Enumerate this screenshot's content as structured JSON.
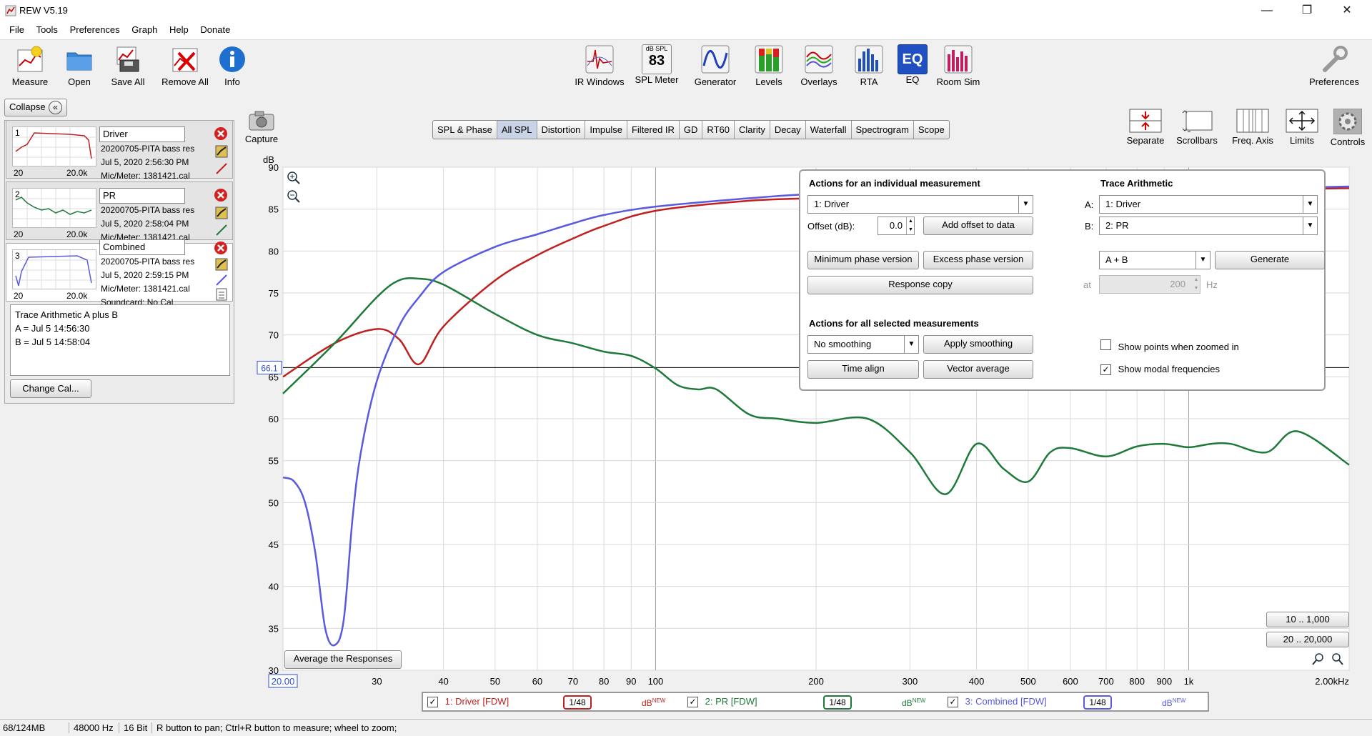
{
  "window": {
    "title": "REW V5.19",
    "controls": {
      "minimize": "—",
      "restore": "❐",
      "close": "✕"
    }
  },
  "menu": [
    "File",
    "Tools",
    "Preferences",
    "Graph",
    "Help",
    "Donate"
  ],
  "toolbar_left": [
    {
      "label": "Measure",
      "icon": "measure-icon"
    },
    {
      "label": "Open",
      "icon": "folder-icon"
    },
    {
      "label": "Save All",
      "icon": "save-icon"
    },
    {
      "label": "Remove All",
      "icon": "remove-icon"
    },
    {
      "label": "Info",
      "icon": "info-icon"
    }
  ],
  "toolbar_mid": [
    {
      "label": "IR Windows",
      "icon": "ir-windows-icon"
    },
    {
      "label": "SPL Meter",
      "icon": "spl-meter-icon"
    },
    {
      "label": "Generator",
      "icon": "generator-icon"
    },
    {
      "label": "Levels",
      "icon": "levels-icon"
    },
    {
      "label": "Overlays",
      "icon": "overlays-icon"
    },
    {
      "label": "RTA",
      "icon": "rta-icon"
    },
    {
      "label": "EQ",
      "icon": "eq-icon"
    },
    {
      "label": "Room Sim",
      "icon": "room-sim-icon"
    }
  ],
  "spl_meter_icon": {
    "top": "dB SPL",
    "value": "83"
  },
  "eq_icon_text": "EQ",
  "preferences": "Preferences",
  "graph_tools": [
    "Separate",
    "Scrollbars",
    "Freq. Axis",
    "Limits",
    "Controls"
  ],
  "capture": "Capture",
  "collapse": "Collapse",
  "tabs": [
    "SPL & Phase",
    "All SPL",
    "Distortion",
    "Impulse",
    "Filtered IR",
    "GD",
    "RT60",
    "Clarity",
    "Decay",
    "Waterfall",
    "Spectrogram",
    "Scope"
  ],
  "selected_tab": "All SPL",
  "measurements": [
    {
      "num": "1",
      "name": "Driver",
      "line1": "20200705-PITA bass res",
      "line2": "Jul 5, 2020 2:56:30 PM",
      "line3": "Mic/Meter: 1381421.cal",
      "line4": "S",
      "color": "#c0201f"
    },
    {
      "num": "2",
      "name": "PR",
      "line1": "20200705-PITA bass res",
      "line2": "Jul 5, 2020 2:58:04 PM",
      "line3": "Mic/Meter: 1381421.cal",
      "line4": "S",
      "color": "#1f7a3a"
    },
    {
      "num": "3",
      "name": "Combined",
      "line1": "20200705-PITA bass res",
      "line2": "Jul 5, 2020 2:59:15 PM",
      "line3": "Mic/Meter: 1381421.cal",
      "line4": "Soundcard: No Cal",
      "color": "#5a5ae0"
    }
  ],
  "thumb_axis": {
    "left": "20",
    "right": "20.0k"
  },
  "notes": [
    "Trace Arithmetic A plus B",
    "A = Jul 5 14:56:30",
    "B = Jul 5 14:58:04"
  ],
  "change_cal": "Change Cal...",
  "controls_panel": {
    "individual_title": "Actions for an individual measurement",
    "measurement_select": "1: Driver",
    "offset_label": "Offset (dB):",
    "offset_value": "0.0",
    "add_offset": "Add offset to data",
    "min_phase": "Minimum phase version",
    "excess_phase": "Excess phase version",
    "response_copy": "Response copy",
    "all_title": "Actions for all selected measurements",
    "smoothing_select": "No smoothing",
    "apply_smoothing": "Apply smoothing",
    "time_align": "Time align",
    "vector_average": "Vector average",
    "trace_title": "Trace Arithmetic",
    "a_label": "A:",
    "a_value": "1: Driver",
    "b_label": "B:",
    "b_value": "2: PR",
    "op_value": "A + B",
    "generate": "Generate",
    "at_label": "at",
    "at_value": "200",
    "hz_label": "Hz",
    "show_points": "Show points when zoomed in",
    "show_points_checked": false,
    "show_modal": "Show modal frequencies",
    "show_modal_checked": true
  },
  "chart_data": {
    "type": "line",
    "ylabel": "dB",
    "y_ticks": [
      "90",
      "85",
      "80",
      "75",
      "70",
      "65",
      "60",
      "55",
      "50",
      "45",
      "40",
      "35",
      "30"
    ],
    "ylim": [
      30,
      90
    ],
    "x_ticks": [
      "20.00",
      "30",
      "40",
      "50",
      "60",
      "70",
      "80",
      "90",
      "100",
      "200",
      "300",
      "400",
      "500",
      "600",
      "700",
      "800",
      "900",
      "1k",
      "2.00kHz"
    ],
    "xlim": [
      20,
      2000
    ],
    "x_scale": "log",
    "cursor_value": "66.1",
    "series": [
      {
        "name": "1: Driver [FDW]",
        "color": "#c0201f",
        "x": [
          20,
          25,
          30,
          33,
          36,
          40,
          50,
          60,
          70,
          80,
          100,
          150,
          200,
          300,
          400,
          600,
          1000,
          2000
        ],
        "y": [
          65,
          69,
          70.7,
          69.5,
          66.5,
          71,
          76.5,
          79.5,
          81.5,
          83,
          84.8,
          86,
          86.3,
          86.6,
          86.8,
          87,
          87.2,
          87.5
        ]
      },
      {
        "name": "2: PR [FDW]",
        "color": "#1f7a3a",
        "x": [
          20,
          25,
          30,
          33,
          36,
          40,
          50,
          60,
          70,
          80,
          90,
          100,
          110,
          120,
          130,
          150,
          170,
          200,
          250,
          300,
          350,
          400,
          450,
          500,
          550,
          600,
          700,
          800,
          900,
          1000,
          1100,
          1200,
          1400,
          1600,
          2000
        ],
        "y": [
          63,
          69,
          74.5,
          76.5,
          76.7,
          76,
          72.5,
          70,
          69,
          68,
          67.5,
          66,
          64,
          63.5,
          63.5,
          60.5,
          60,
          59.5,
          60,
          56,
          51,
          57,
          54,
          52.5,
          56,
          56.5,
          55.5,
          56.7,
          57,
          56.6,
          57,
          57,
          56,
          58.5,
          54.5
        ]
      },
      {
        "name": "3: Combined [FDW]",
        "color": "#5a5ae0",
        "x": [
          20,
          21,
          22,
          23,
          24,
          25,
          26,
          27,
          28,
          30,
          33,
          36,
          40,
          50,
          60,
          70,
          80,
          100,
          150,
          200,
          300,
          400,
          600,
          1000,
          2000
        ],
        "y": [
          53,
          52.5,
          50,
          44,
          35,
          33,
          36,
          48,
          56,
          64.5,
          71,
          74.5,
          77.5,
          80.5,
          82,
          83.3,
          84.3,
          85.3,
          86.3,
          86.8,
          86.9,
          87,
          87.1,
          87.3,
          87.7
        ]
      }
    ]
  },
  "graph_buttons": {
    "average": "Average the Responses",
    "range1": "10 .. 1,000",
    "range2": "20 .. 20,000"
  },
  "legend": [
    {
      "label": "1: Driver [FDW]",
      "smooth": "1/48",
      "unit": "dB",
      "sup": "NEW",
      "color": "#c0201f"
    },
    {
      "label": "2: PR [FDW]",
      "smooth": "1/48",
      "unit": "dB",
      "sup": "NEW",
      "color": "#1f7a3a"
    },
    {
      "label": "3: Combined [FDW]",
      "smooth": "1/48",
      "unit": "dB",
      "sup": "NEW",
      "color": "#5a5ae0"
    }
  ],
  "status": {
    "mem": "68/124MB",
    "rate": "48000 Hz",
    "bits": "16 Bit",
    "hint": "R button to pan; Ctrl+R button to measure; wheel to zoom;"
  }
}
